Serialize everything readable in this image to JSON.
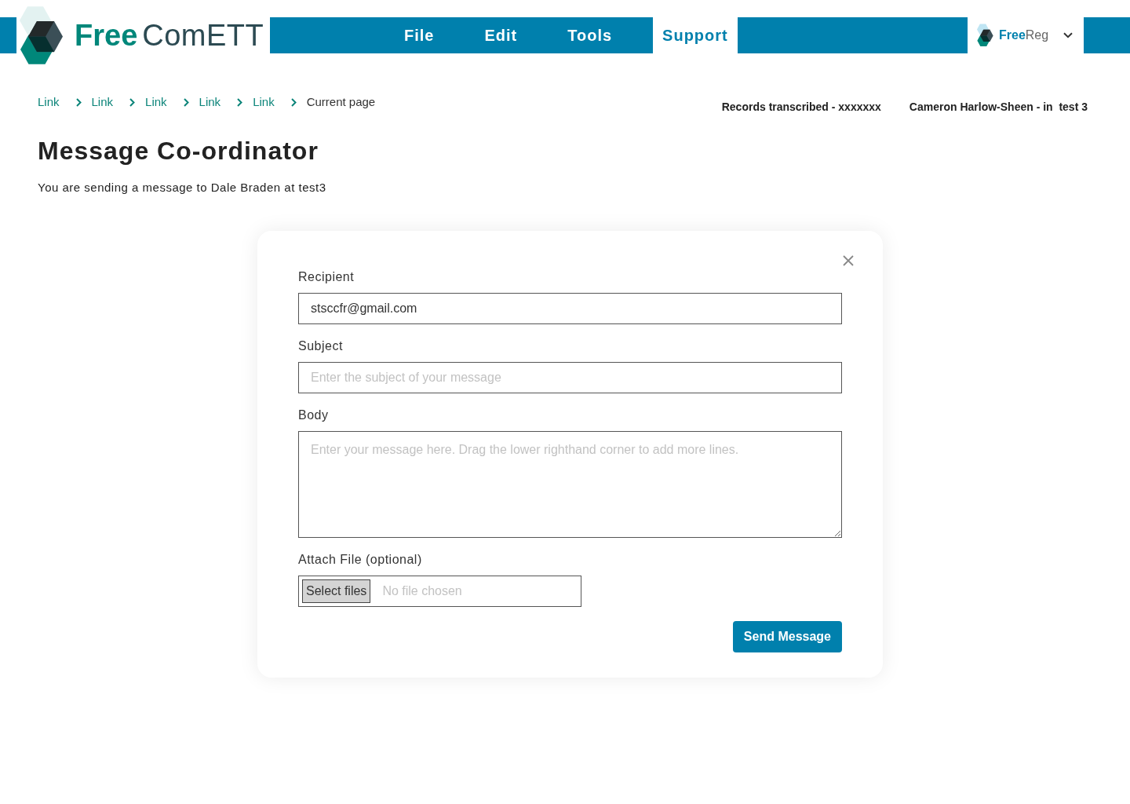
{
  "header": {
    "logo": {
      "bold": "Free",
      "light": "ComETT"
    },
    "menu": [
      {
        "label": "File",
        "selected": false
      },
      {
        "label": "Edit",
        "selected": false
      },
      {
        "label": "Tools",
        "selected": false
      },
      {
        "label": "Support",
        "selected": true
      }
    ],
    "account_logo": {
      "bold": "Free",
      "light": "Reg"
    }
  },
  "breadcrumb": {
    "links": [
      "Link",
      "Link",
      "Link",
      "Link",
      "Link"
    ],
    "current": "Current page"
  },
  "status": {
    "records": "Records transcribed - xxxxxxx",
    "user": "Cameron Harlow-Sheen - in  test 3"
  },
  "page": {
    "title": "Message Co-ordinator",
    "intro": "You are sending a message to Dale Braden at test3"
  },
  "form": {
    "fields": [
      {
        "kind": "text",
        "label": "Recipient",
        "value": "stsccfr@gmail.com"
      },
      {
        "kind": "text",
        "label": "Subject",
        "placeholder": "Enter the subject of your message"
      },
      {
        "kind": "textarea",
        "label": "Body",
        "placeholder": "Enter your message here. Drag the lower righthand corner to add more lines."
      },
      {
        "kind": "file",
        "label": "Attach File (optional)",
        "button": "Select files",
        "status": "No file chosen"
      }
    ],
    "submit": "Send Message"
  }
}
